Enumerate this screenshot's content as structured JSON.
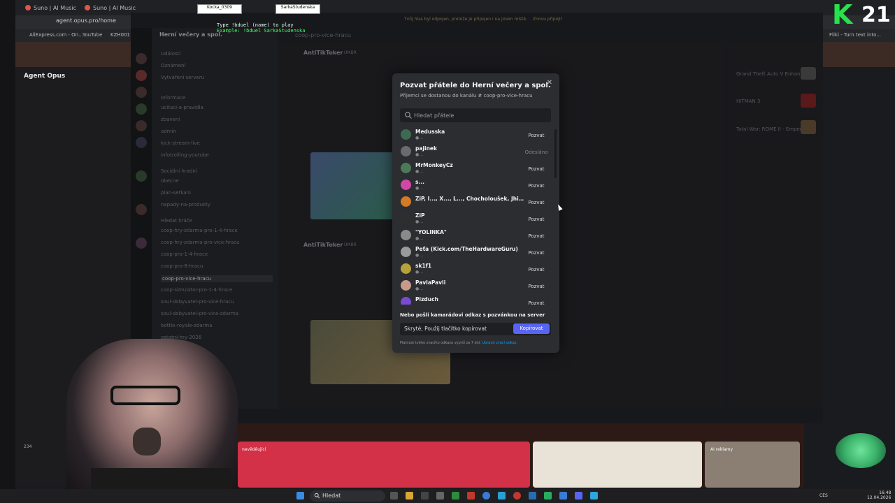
{
  "browser": {
    "tabs": [
      "Suno | AI Music",
      "Suno | AI Music"
    ],
    "url": "agent.opus.pro/home",
    "bookmarks": [
      "AliExpress.com - On...",
      "YouTube",
      "KZH001",
      "Fliki - Turn text into..."
    ],
    "sidebar_title": "Agent Opus",
    "notification_count": "234"
  },
  "discord": {
    "server_name": "Herní večery a spol.",
    "banner": "Tvůj hlas byl odpojen, protože je připojen i na jiném místě.",
    "banner_action": "Znovu připojit",
    "channels": [
      "Události",
      "Oznámení",
      "Vytváření serveru",
      "Informace",
      "ucitaci-a-pravidla",
      "zbaveni",
      "admin",
      "kick-stream-live",
      "infotrolling-youtube",
      "Sociální hradní",
      "obecne",
      "plan-setkani",
      "napady-na-produkty",
      "Hledat hráče",
      "coop-hry-zdarma-pro-1-4-hrace",
      "coop-hry-zdarma-pro-vice-hracu",
      "coop-pro-1-4-hrace",
      "coop-pro-8-hracu",
      "coop-pro-vice-hracu",
      "coop-simulator-pro-1-4-hrace",
      "soul-dobyvatel-pro-vice-hracu",
      "soul-dobyvatel-pro-vice-zdarma",
      "bottle-royale-zdarma",
      "ostatni-hry-2026"
    ],
    "active_channel": "coop-pro-vice-hracu",
    "chat_channel_header": "coop-pro-vice-hracu",
    "messages": [
      {
        "author": "AntiTikToker",
        "tag": "UMBR"
      },
      {
        "author": "AntiTikToker",
        "tag": "UMBR"
      }
    ],
    "members": [
      "Grand Theft Auto V Enhan...",
      "HITMAN 3",
      "Total War: ROME II - Emper..."
    ]
  },
  "modal": {
    "title": "Pozvat přátele do Herní večery a spol.",
    "subtitle": "Příjemci se dostanou do kanálu # coop-pro-vice-hracu",
    "search_placeholder": "Hledat přátele",
    "friends": [
      {
        "name": "Medusska",
        "status": "invite",
        "button": "Pozvat",
        "color": "#3d6b52"
      },
      {
        "name": "pajinek",
        "status": "sent",
        "button": "Odesláno",
        "color": "#6b6b6b"
      },
      {
        "name": "MrMonkeyCz",
        "status": "invite",
        "button": "Pozvat",
        "color": "#4a7a5a"
      },
      {
        "name": "s...",
        "status": "invite",
        "button": "Pozvat",
        "color": "#d048a6"
      },
      {
        "name": "ZiP, I..., X..., L..., Chocholoušek, Jhinney ꜱꜱ, ...",
        "status": "invite",
        "button": "Pozvat",
        "color": "#d47a24"
      },
      {
        "name": "ZiP",
        "status": "invite",
        "button": "Pozvat",
        "color": "#2e2e2e"
      },
      {
        "name": "\"YOLINKA\"",
        "status": "invite",
        "button": "Pozvat",
        "color": "#8a8a8a"
      },
      {
        "name": "Peťa (Kick.com/TheHardwareGuru)",
        "status": "invite",
        "button": "Pozvat",
        "color": "#9a9a9a"
      },
      {
        "name": "sk1f1",
        "status": "invite",
        "button": "Pozvat",
        "color": "#b5a23a"
      },
      {
        "name": "PavlaPavli",
        "status": "invite",
        "button": "Pozvat",
        "color": "#c89a8a"
      },
      {
        "name": "Pizduch",
        "status": "invite",
        "button": "Pozvat",
        "color": "#7a4ad0"
      }
    ],
    "link_heading": "Nebo pošli kamarádovi odkaz s pozvánkou na server",
    "link_value": "Skryté; Použij tlačítko kopírovat",
    "copy_label": "Kopírovat",
    "link_note": "Platnost tvého zvacího odkazu vyprší za 7 dní.",
    "link_note_action": "Upravit zvací odkaz."
  },
  "overlay": {
    "counter_letter": "K",
    "counter_number": "21",
    "duel_line1": "Type !bduel (name) to play",
    "duel_line2": "Example: !bduel SarkaStudenska",
    "duel_left": "Kocka_0309",
    "duel_right": "SarkaStudenska",
    "stream_tag": "nevěděující",
    "card_right": "AI reklamy"
  },
  "taskbar": {
    "search_label": "Hledat",
    "lang": "CES",
    "time": "16:48",
    "date": "12.04.2026"
  }
}
